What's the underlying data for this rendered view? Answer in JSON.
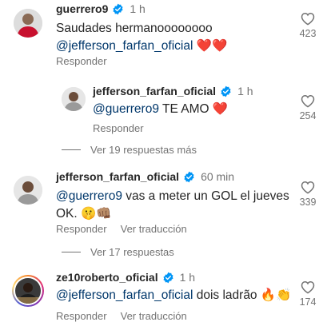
{
  "comments": [
    {
      "username": "guerrero9",
      "time": "1 h",
      "text_line1": "Saudades hermanoooooooo",
      "mention": "@jefferson_farfan_oficial",
      "emoji": "❤️❤️",
      "reply": "Responder",
      "likes": "423"
    },
    {
      "username": "jefferson_farfan_oficial",
      "time": "1 h",
      "mention": "@guerrero9",
      "text": " TE AMO ",
      "emoji": "❤️",
      "reply": "Responder",
      "likes": "254"
    },
    {
      "username": "jefferson_farfan_oficial",
      "time": "60 min",
      "mention": "@guerrero9",
      "text_line1": " vas a meter un GOL el jueves",
      "text_line2": "OK. ",
      "emoji": "🤫👊🏽",
      "reply": "Responder",
      "translate": "Ver traducción",
      "likes": "339"
    },
    {
      "username": "ze10roberto_oficial",
      "time": "1 h",
      "mention": "@jefferson_farfan_oficial",
      "text": " dois ladrão ",
      "emoji": "🔥👏",
      "reply": "Responder",
      "translate": "Ver traducción",
      "likes": "174"
    }
  ],
  "view_replies": [
    "Ver 19 respuestas más",
    "Ver 17 respuestas"
  ],
  "colors": {
    "verified": "#0095f6",
    "heart": "#ed4956",
    "mention": "#00376b",
    "secondary": "#737373"
  },
  "icons": {
    "verified": "verified-badge-icon",
    "like": "heart-outline-icon"
  }
}
